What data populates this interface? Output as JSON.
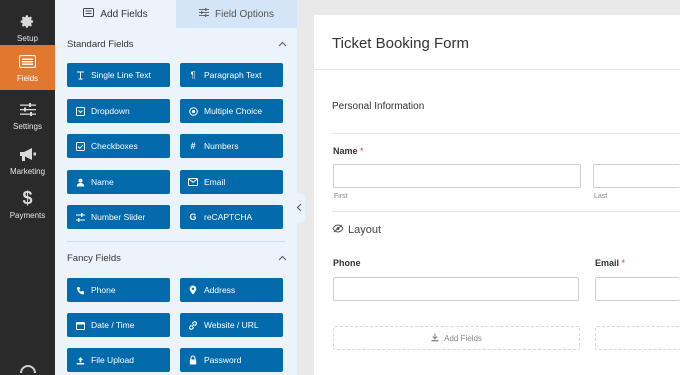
{
  "nav": {
    "items": [
      {
        "label": "Setup",
        "icon": "gear-icon"
      },
      {
        "label": "Fields",
        "icon": "fields-icon"
      },
      {
        "label": "Settings",
        "icon": "sliders-icon"
      },
      {
        "label": "Marketing",
        "icon": "megaphone-icon"
      },
      {
        "label": "Payments",
        "icon": "dollar-icon"
      }
    ],
    "active": "Fields"
  },
  "panel": {
    "tabs": [
      {
        "label": "Add Fields",
        "icon": "list-icon"
      },
      {
        "label": "Field Options",
        "icon": "sliders-icon"
      }
    ],
    "standard": {
      "title": "Standard Fields",
      "buttons": [
        {
          "label": "Single Line Text",
          "icon": "text-cursor-icon"
        },
        {
          "label": "Paragraph Text",
          "icon": "paragraph-icon"
        },
        {
          "label": "Dropdown",
          "icon": "dropdown-icon"
        },
        {
          "label": "Multiple Choice",
          "icon": "radio-icon"
        },
        {
          "label": "Checkboxes",
          "icon": "checkbox-icon"
        },
        {
          "label": "Numbers",
          "icon": "hash-icon"
        },
        {
          "label": "Name",
          "icon": "user-icon"
        },
        {
          "label": "Email",
          "icon": "envelope-icon"
        },
        {
          "label": "Number Slider",
          "icon": "slider-icon"
        },
        {
          "label": "reCAPTCHA",
          "icon": "google-icon"
        }
      ]
    },
    "fancy": {
      "title": "Fancy Fields",
      "buttons": [
        {
          "label": "Phone",
          "icon": "phone-icon"
        },
        {
          "label": "Address",
          "icon": "map-pin-icon"
        },
        {
          "label": "Date / Time",
          "icon": "calendar-icon"
        },
        {
          "label": "Website / URL",
          "icon": "link-icon"
        },
        {
          "label": "File Upload",
          "icon": "upload-icon"
        },
        {
          "label": "Password",
          "icon": "lock-icon"
        }
      ]
    }
  },
  "form": {
    "title": "Ticket Booking Form",
    "section": "Personal Information",
    "name_label": "Name",
    "required_mark": "*",
    "first_sub": "First",
    "last_sub": "Last",
    "layout_label": "Layout",
    "phone_label": "Phone",
    "email_label": "Email",
    "add_fields": "Add Fields"
  },
  "colors": {
    "nav_bg": "#2a2a2a",
    "nav_active": "#e27730",
    "button": "#036aab",
    "panel_bg": "#ebf3fb"
  }
}
